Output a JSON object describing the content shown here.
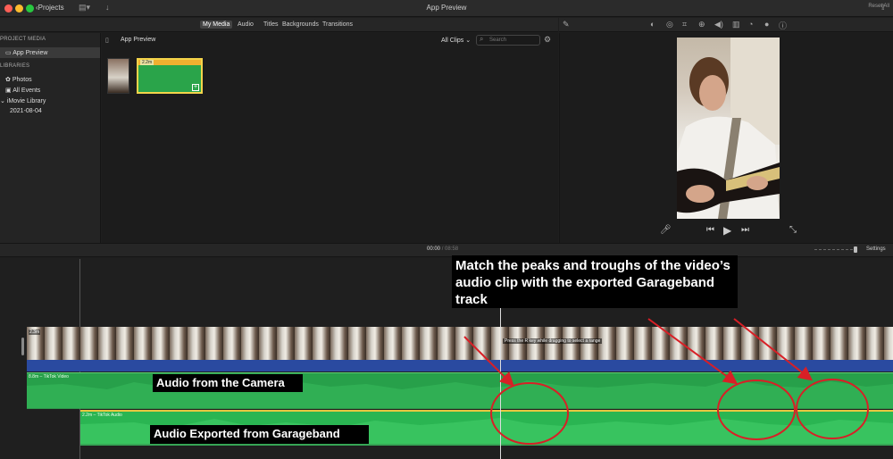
{
  "window": {
    "title": "App Preview",
    "projects_label": "Projects"
  },
  "media_tabs": [
    "My Media",
    "Audio",
    "Titles",
    "Backgrounds",
    "Transitions"
  ],
  "inspector": {
    "reset_label": "Reset All"
  },
  "sidebar": {
    "project_media_header": "PROJECT MEDIA",
    "project_item": "App Preview",
    "libraries_header": "LIBRARIES",
    "library_items": [
      "Photos",
      "All Events"
    ],
    "library_name": "iMovie Library",
    "event_date": "2021-08-04"
  },
  "browser": {
    "title": "App Preview",
    "filter": "All Clips",
    "search_placeholder": "Search",
    "clip_duration": "2.2m"
  },
  "timeline": {
    "timecode_current": "00:00",
    "timecode_sep": "/",
    "timecode_total": "08:58",
    "settings_label": "Settings",
    "video_clip_duration": "2.3m",
    "hint": "Press the R key while dragging to select a range",
    "audio1_label": "8.8m – TikTok Video",
    "audio2_label": "2.2m – TikTok Audio"
  },
  "annotations": {
    "main": "Match the peaks and troughs of the video’s audio clip with the exported Garageband track",
    "camera": "Audio from the Camera",
    "garageband": "Audio Exported from Garageband",
    "color": "#d81f26"
  },
  "colors": {
    "audio_green": "#27a04a",
    "video_blue": "#2a4aa0",
    "selection_yellow": "#e8c640"
  }
}
